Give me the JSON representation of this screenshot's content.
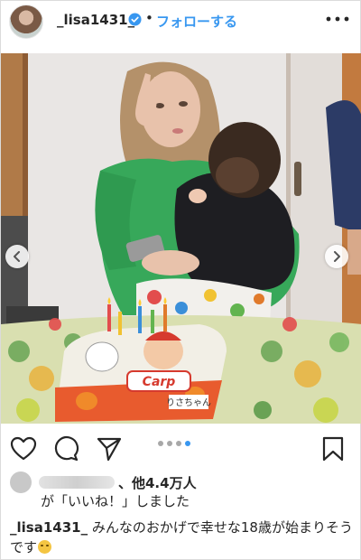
{
  "header": {
    "username": "_lisa1431_",
    "separator": "•",
    "follow_label": "フォローする",
    "verified_icon": "verified-badge-icon",
    "more_icon": "more-options-icon"
  },
  "post": {
    "cake_text": "Carp",
    "cake_plate_text": "りさちゃん",
    "carousel": {
      "total": 4,
      "active_index": 3
    }
  },
  "actions": {
    "like_icon": "heart-icon",
    "comment_icon": "comment-icon",
    "share_icon": "share-icon",
    "save_icon": "bookmark-icon"
  },
  "likes": {
    "count_text": "、他4.4万人",
    "liked_text": "が「いいね！」しました"
  },
  "caption": {
    "username": "_lisa1431_",
    "text": " みんなのおかげで幸せな18歳が始まりそうです"
  },
  "colors": {
    "link_blue": "#3897f0",
    "verified_blue": "#3897f0",
    "text": "#262626"
  }
}
